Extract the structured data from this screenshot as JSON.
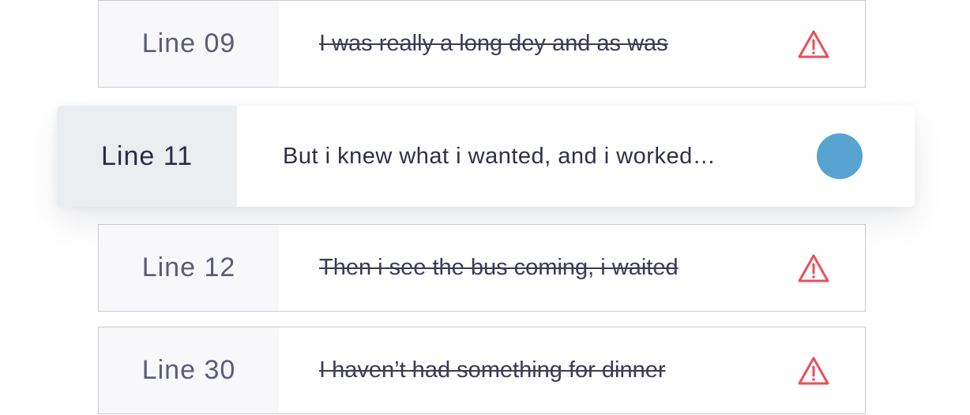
{
  "colors": {
    "warning": "#e8505b",
    "active_dot": "#58a3cf"
  },
  "lines": [
    {
      "label": "Line 09",
      "text": "I was really a long dey and as was",
      "state": "struck",
      "icon": "warning-icon"
    },
    {
      "label": "Line 11",
      "text": "But i knew what i wanted, and i worked…",
      "state": "active",
      "icon": "status-dot"
    },
    {
      "label": "Line 12",
      "text": "Then i see the bus coming, i waited",
      "state": "struck",
      "icon": "warning-icon"
    },
    {
      "label": "Line 30",
      "text": "I haven’t had something for dinner",
      "state": "struck",
      "icon": "warning-icon"
    }
  ]
}
